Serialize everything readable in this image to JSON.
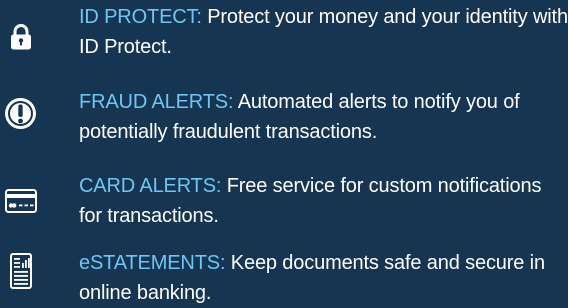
{
  "colors": {
    "background": "#163553",
    "title_accent": "#6ec6f1",
    "body_text": "#ffffff"
  },
  "features": [
    {
      "icon": "lock-icon",
      "title": "ID PROTECT:",
      "description": " Protect your money and your identity with ID Protect."
    },
    {
      "icon": "alert-icon",
      "title": "FRAUD ALERTS:",
      "description": " Automated alerts to notify you of potentially fraudulent transactions."
    },
    {
      "icon": "credit-card-icon",
      "title": "CARD ALERTS:",
      "description": " Free service for custom notifications for transactions."
    },
    {
      "icon": "statement-document-icon",
      "title": "eSTATEMENTS:",
      "description": " Keep documents safe and secure in online banking."
    }
  ]
}
